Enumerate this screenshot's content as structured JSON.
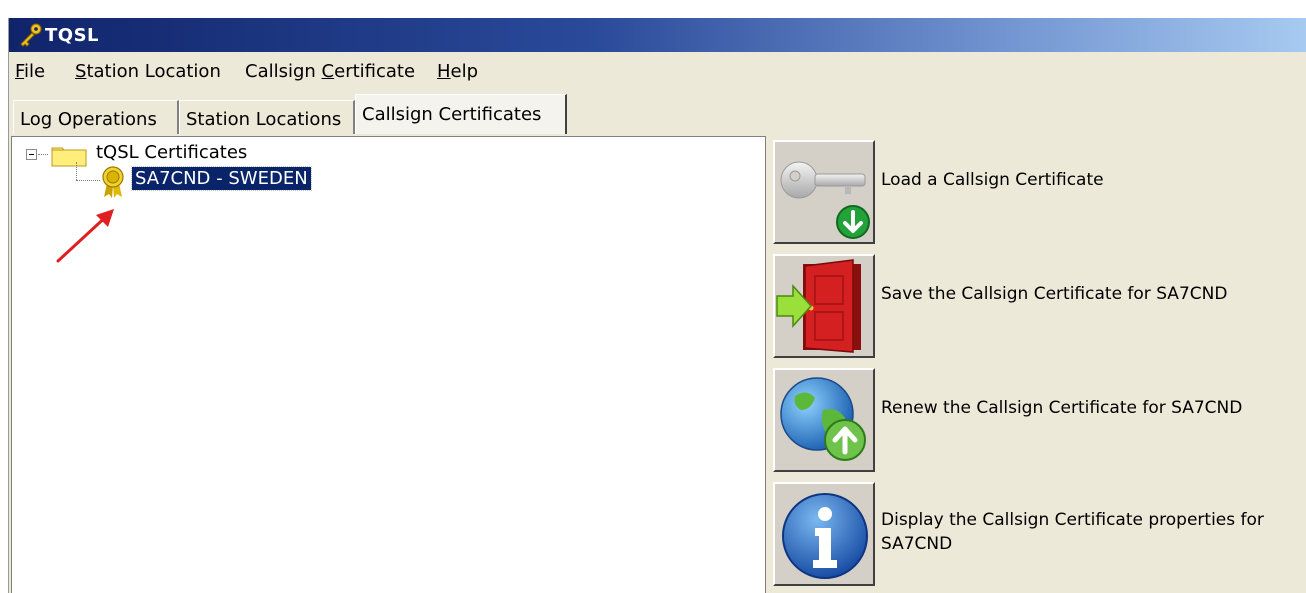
{
  "window": {
    "title": "TQSL"
  },
  "menu": {
    "items": [
      {
        "pre": "",
        "key": "F",
        "post": "ile"
      },
      {
        "pre": "",
        "key": "S",
        "post": "tation Location"
      },
      {
        "pre": "Callsign ",
        "key": "C",
        "post": "ertificate"
      },
      {
        "pre": "",
        "key": "H",
        "post": "elp"
      }
    ]
  },
  "tabs": [
    {
      "label": "Log Operations"
    },
    {
      "label": "Station Locations"
    },
    {
      "label": "Callsign Certificates",
      "active": true
    }
  ],
  "tree": {
    "root_label": "tQSL Certificates",
    "cert_label": "SA7CND - SWEDEN"
  },
  "actions": [
    {
      "label": "Load a Callsign Certificate",
      "icon": "key-download-icon"
    },
    {
      "label": "Save the Callsign Certificate for SA7CND",
      "icon": "door-save-icon"
    },
    {
      "label": "Renew the Callsign Certificate for SA7CND",
      "icon": "globe-upload-icon"
    },
    {
      "label": "Display the Callsign Certificate properties for SA7CND",
      "icon": "info-icon"
    }
  ],
  "colors": {
    "selection": "#0a246a",
    "annotation_arrow": "#e02020"
  }
}
